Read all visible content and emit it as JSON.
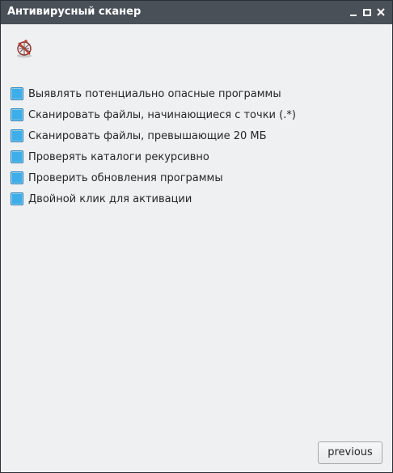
{
  "window": {
    "title": "Антивирусный сканер"
  },
  "app_icon": {
    "name": "antivirus-scanner-icon"
  },
  "options": [
    {
      "label": "Выявлять потенциально опасные программы",
      "checked": true
    },
    {
      "label": "Сканировать файлы, начинающиеся с точки (.*)",
      "checked": true
    },
    {
      "label": "Сканировать файлы, превышающие 20 МБ",
      "checked": true
    },
    {
      "label": "Проверять каталоги рекурсивно",
      "checked": true
    },
    {
      "label": "Проверить обновления программы",
      "checked": true
    },
    {
      "label": "Двойной клик для активации",
      "checked": true
    }
  ],
  "footer": {
    "previous_label": "previous"
  },
  "colors": {
    "titlebar": "#4a5058",
    "window_bg": "#eff0f1",
    "checkbox_fill": "#3daee9",
    "checkbox_border": "#2980b9"
  }
}
